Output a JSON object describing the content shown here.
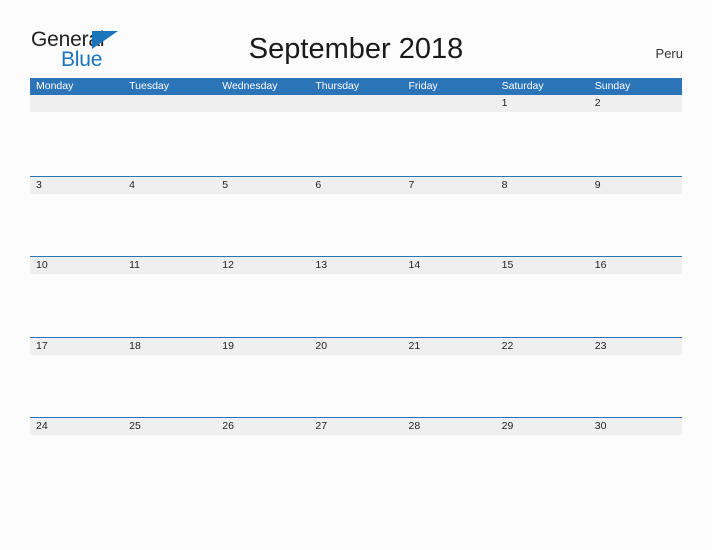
{
  "brand": {
    "name_part1": "General",
    "name_part2": "Blue",
    "triangle_icon": "blue-triangle-icon",
    "color_dark": "#231f20",
    "color_blue": "#1b75bb"
  },
  "header": {
    "title": "September 2018",
    "country": "Peru"
  },
  "calendar": {
    "accent_color": "#2b74b8",
    "band_color": "#efefef",
    "weekdays": [
      "Monday",
      "Tuesday",
      "Wednesday",
      "Thursday",
      "Friday",
      "Saturday",
      "Sunday"
    ],
    "weeks": [
      [
        "",
        "",
        "",
        "",
        "",
        "1",
        "2"
      ],
      [
        "3",
        "4",
        "5",
        "6",
        "7",
        "8",
        "9"
      ],
      [
        "10",
        "11",
        "12",
        "13",
        "14",
        "15",
        "16"
      ],
      [
        "17",
        "18",
        "19",
        "20",
        "21",
        "22",
        "23"
      ],
      [
        "24",
        "25",
        "26",
        "27",
        "28",
        "29",
        "30"
      ]
    ]
  }
}
